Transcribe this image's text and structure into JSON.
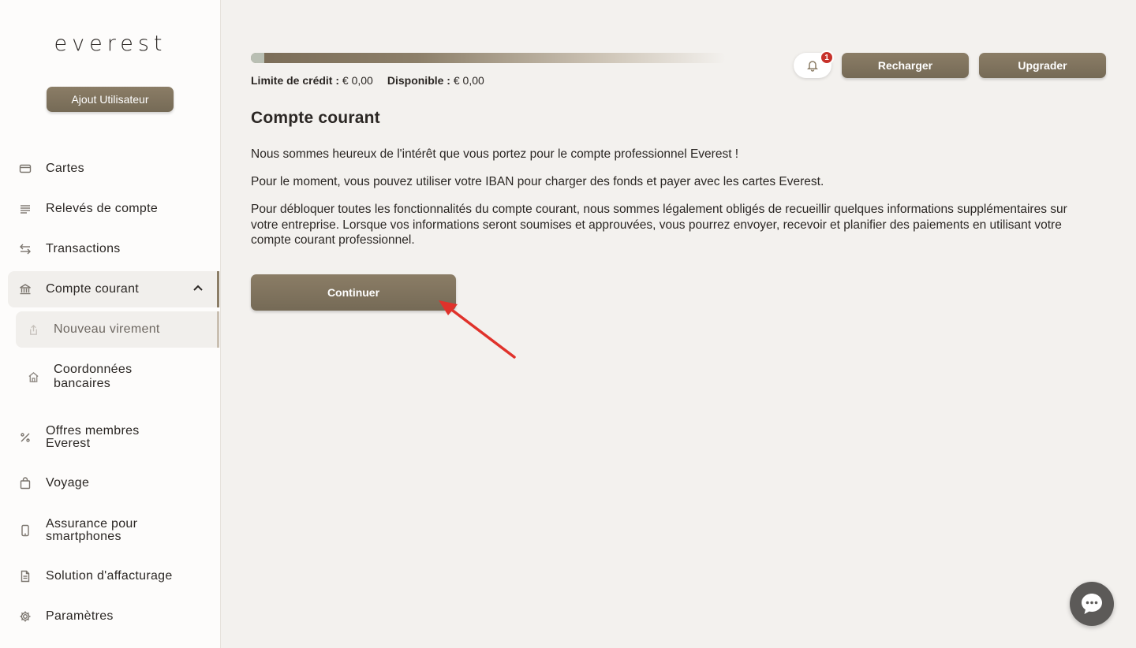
{
  "sidebar": {
    "logo": "everest",
    "add_user_label": "Ajout Utilisateur",
    "items": [
      {
        "label": "Cartes",
        "icon": "card-icon"
      },
      {
        "label": "Relevés de compte",
        "icon": "lines-icon"
      },
      {
        "label": "Transactions",
        "icon": "transfer-arrows-icon"
      },
      {
        "label": "Compte courant",
        "icon": "bank-icon"
      },
      {
        "label": "Offres membres Everest",
        "icon": "percent-icon"
      },
      {
        "label": "Voyage",
        "icon": "bag-icon"
      },
      {
        "label": "Assurance pour smartphones",
        "icon": "smartphone-icon"
      },
      {
        "label": "Solution d'affacturage",
        "icon": "document-icon"
      },
      {
        "label": "Paramètres",
        "icon": "gear-icon"
      }
    ],
    "sub_items": [
      {
        "label": "Nouveau virement",
        "icon": "upload-icon"
      },
      {
        "label": "Coordonnées bancaires",
        "icon": "home-icon"
      }
    ]
  },
  "header": {
    "credit_limit_label": "Limite de crédit :",
    "credit_limit_value": "€ 0,00",
    "available_label": "Disponible :",
    "available_value": "€ 0,00",
    "notification_count": "1",
    "recharger_label": "Recharger",
    "upgrader_label": "Upgrader"
  },
  "main": {
    "title": "Compte courant",
    "paragraph1": "Nous sommes heureux de l'intérêt que vous portez pour le compte professionnel Everest !",
    "paragraph2": "Pour le moment, vous pouvez utiliser votre IBAN pour charger des fonds et payer avec les cartes Everest.",
    "paragraph3": "Pour débloquer toutes les fonctionnalités du compte courant, nous sommes légalement obligés de recueillir quelques informations supplémentaires sur votre entreprise. Lorsque vos informations seront soumises et approuvées, vous pourrez envoyer, recevoir et planifier des paiements en utilisant votre compte courant professionnel.",
    "continue_label": "Continuer"
  },
  "colors": {
    "accent": "#8b7d66",
    "badge": "#c7322b",
    "arrow": "#e0322b"
  }
}
